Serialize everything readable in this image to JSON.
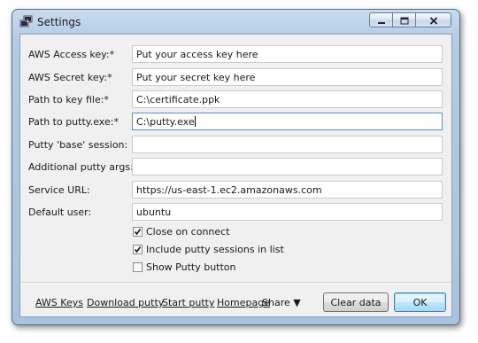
{
  "window": {
    "title": "Settings",
    "icon": "putty-terminal-icon",
    "controls": [
      "minimize-icon",
      "maximize-icon",
      "close-icon"
    ]
  },
  "fields": [
    {
      "label": "AWS Access key:*",
      "value": "Put your access key here"
    },
    {
      "label": "AWS Secret key:*",
      "value": "Put your secret key here"
    },
    {
      "label": "Path to key file:*",
      "value": "C:\\certificate.ppk"
    },
    {
      "label": "Path to putty.exe:*",
      "value": "C:\\putty.exe"
    },
    {
      "label": "Putty 'base' session:",
      "value": ""
    },
    {
      "label": "Additional putty args:",
      "value": ""
    },
    {
      "label": "Service URL:",
      "value": "https://us-east-1.ec2.amazonaws.com"
    },
    {
      "label": "Default user:",
      "value": "ubuntu"
    }
  ],
  "options": [
    {
      "label": "Close on connect",
      "checked": true
    },
    {
      "label": "Include putty sessions in list",
      "checked": true
    },
    {
      "label": "Show Putty button",
      "checked": false
    }
  ],
  "footer": {
    "links": [
      "AWS Keys",
      "Download putty",
      "Start putty",
      "Homepage"
    ],
    "share_label": "Share ▼",
    "clear_label": "Clear data",
    "ok_label": "OK"
  },
  "colors": {
    "frame": "#b3cbe4",
    "client": "#f0f0f0",
    "default_button": "#bee6fd"
  }
}
